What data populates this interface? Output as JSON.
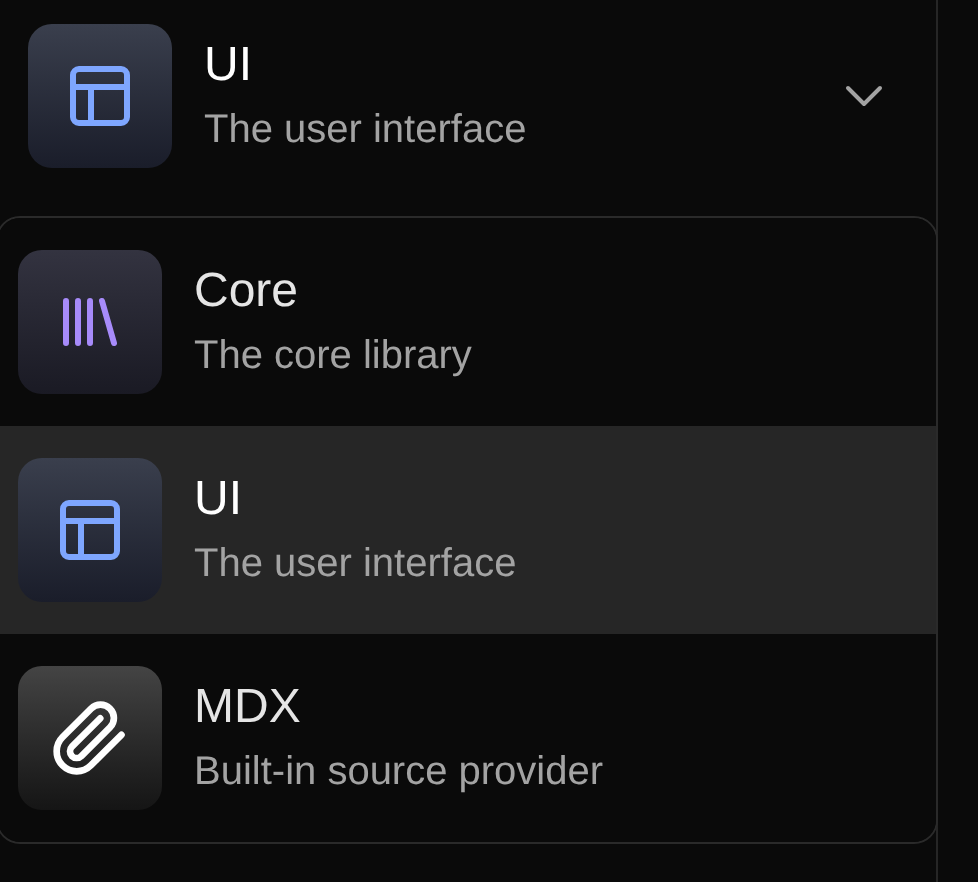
{
  "trigger": {
    "kind": "layout",
    "title": "UI",
    "description": "The user interface"
  },
  "options": [
    {
      "kind": "library",
      "title": "Core",
      "description": "The core library",
      "selected": false
    },
    {
      "kind": "layout",
      "title": "UI",
      "description": "The user interface",
      "selected": true
    },
    {
      "kind": "paperclip",
      "title": "MDX",
      "description": "Built-in source provider",
      "selected": false
    }
  ]
}
